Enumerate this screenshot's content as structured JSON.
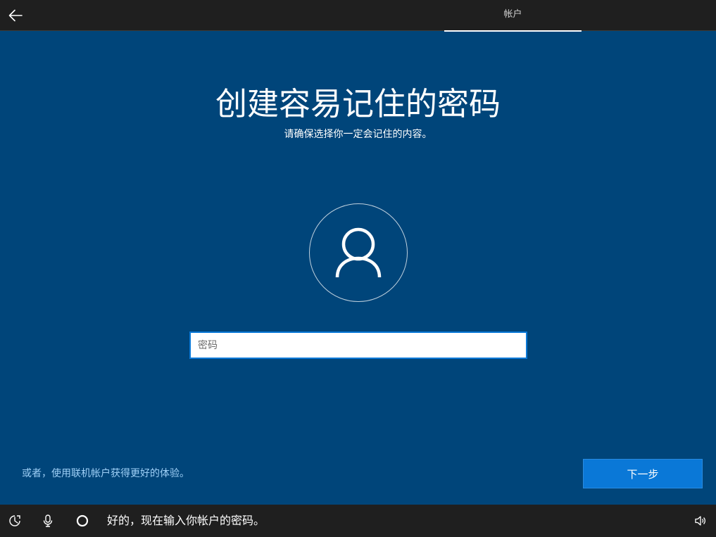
{
  "header": {
    "tab_label": "帐户"
  },
  "main": {
    "title": "创建容易记住的密码",
    "subtitle": "请确保选择你一定会记住的内容。",
    "password_placeholder": "密码",
    "online_account_link": "或者，使用联机帐户获得更好的体验。",
    "next_label": "下一步"
  },
  "footer": {
    "cortana_message": "好的，现在输入你帐户的密码。"
  },
  "icons": {
    "back": "back-arrow-icon",
    "avatar": "user-icon",
    "ease_of_access": "ease-of-access-icon",
    "microphone": "microphone-icon",
    "cortana": "cortana-circle-icon",
    "volume": "volume-icon"
  },
  "colors": {
    "background": "#00457a",
    "bar": "#1f1f1f",
    "accent": "#0a78d7",
    "link": "#9fd0f7"
  }
}
